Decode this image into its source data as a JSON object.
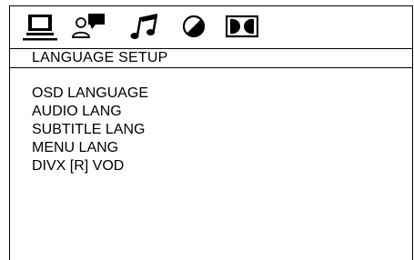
{
  "icons": [
    {
      "name": "monitor-icon"
    },
    {
      "name": "speaker-person-icon"
    },
    {
      "name": "music-note-icon"
    },
    {
      "name": "half-circle-icon"
    },
    {
      "name": "dolby-icon"
    }
  ],
  "header": {
    "title": "LANGUAGE SETUP"
  },
  "menu": {
    "items": [
      {
        "label": "OSD LANGUAGE"
      },
      {
        "label": "AUDIO LANG"
      },
      {
        "label": "SUBTITLE LANG"
      },
      {
        "label": "MENU LANG"
      },
      {
        "label": "DIVX [R] VOD"
      }
    ]
  },
  "colors": {
    "foreground": "#000000",
    "background": "#ffffff"
  }
}
